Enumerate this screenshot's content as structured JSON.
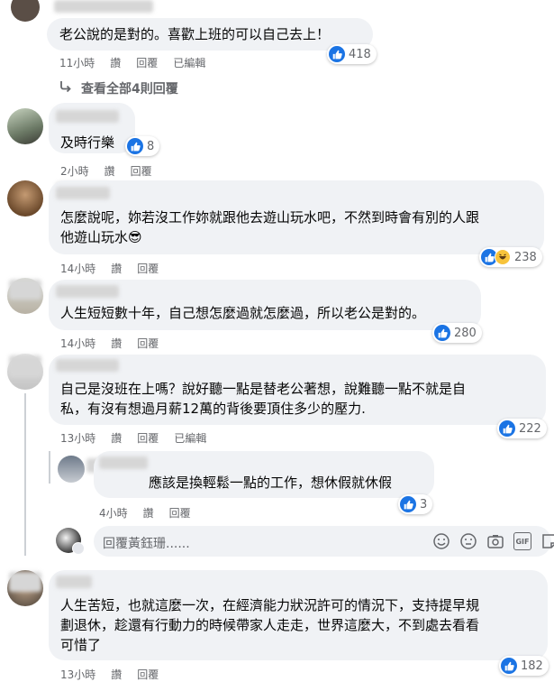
{
  "comments": [
    {
      "text": "老公說的是對的。喜歡上班的可以自己去上！",
      "time": "11小時",
      "like": "讚",
      "reply": "回覆",
      "edited": "已編輯",
      "reactions": "418"
    },
    {
      "replies_link": "查看全部4則回覆"
    },
    {
      "text": "及時行樂",
      "time": "2小時",
      "like": "讚",
      "reply": "回覆",
      "reactions": "8"
    },
    {
      "text": "怎麼說呢，妳若沒工作妳就跟他去遊山玩水吧，不然到時會有別的人跟\n他遊山玩水😎",
      "time": "14小時",
      "like": "讚",
      "reply": "回覆",
      "reactions": "238"
    },
    {
      "text": "人生短短數十年，自己想怎麼過就怎麼過，所以老公是對的。",
      "time": "14小時",
      "like": "讚",
      "reply": "回覆",
      "reactions": "280"
    },
    {
      "text": "自己是沒班在上嗎？說好聽一點是替老公著想，說難聽一點不就是自\n私，有沒有想過月薪12萬的背後要頂住多少的壓力.",
      "time": "13小時",
      "like": "讚",
      "reply": "回覆",
      "edited": "已編輯",
      "reactions": "222"
    },
    {
      "text": "應該是換輕鬆一點的工作，想休假就休假",
      "time": "4小時",
      "like": "讚",
      "reply": "回覆",
      "reactions": "3"
    },
    {
      "reply_placeholder": "回覆黃鈺珊......"
    },
    {
      "text": "人生苦短，也就這麼一次，在經濟能力狀況許可的情況下，支持提早規\n劃退休，趁還有行動力的時候帶家人走走，世界這麼大，不到處去看看\n可惜了",
      "time": "13小時",
      "like": "讚",
      "reply": "回覆",
      "reactions": "182"
    }
  ],
  "composer_icons": [
    "emoji-icon",
    "sticker-icon",
    "camera-icon",
    "gif-icon",
    "sticker-alt-icon"
  ],
  "composer_gif_label": "GIF",
  "colors": {
    "like_blue": "#1b74e4",
    "bubble": "#f0f2f5",
    "meta": "#65676b"
  }
}
